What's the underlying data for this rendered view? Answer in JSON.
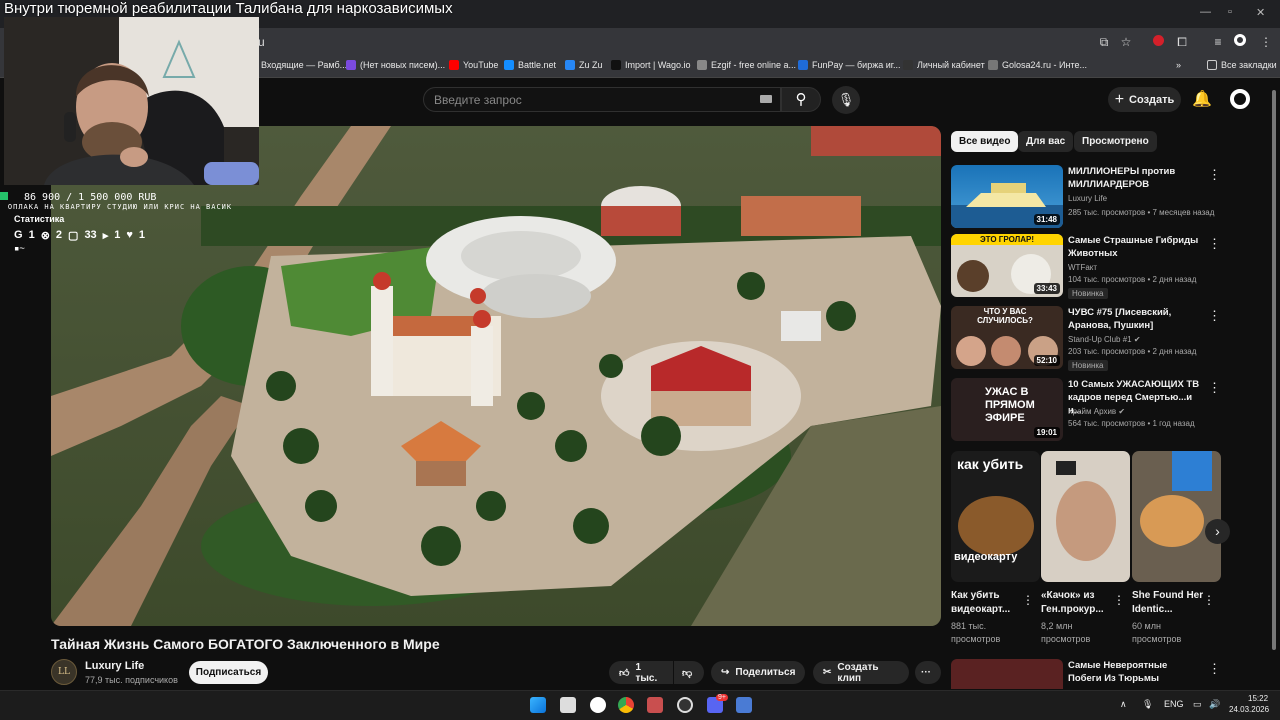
{
  "stream": {
    "title": "Внутри тюремной реабилитации Талибана для наркозависимых",
    "donation": "86 900 / 1 500 000 RUB",
    "donation_note": "ОПЛАКА НА КВАРТИРУ СТУДИЮ ИЛИ КРИС НА ВАСИК",
    "stats_label": "Статистика",
    "stats": [
      "1",
      "2",
      "33",
      "1",
      "1"
    ],
    "stats_extra": "~"
  },
  "browser": {
    "url": "u",
    "bookmarks": [
      {
        "label": "Входящие — Рамб...",
        "color": "#3b6bd6"
      },
      {
        "label": "(Нет новых писем)...",
        "color": "#7b4ae0"
      },
      {
        "label": "YouTube",
        "color": "#ff0000"
      },
      {
        "label": "Battle.net",
        "color": "#148eff"
      },
      {
        "label": "Zu Zu",
        "color": "#2787f5"
      },
      {
        "label": "Import | Wago.io",
        "color": "#111111"
      },
      {
        "label": "Ezgif - free online a...",
        "color": "#888888"
      },
      {
        "label": "FunPay — биржа иг...",
        "color": "#1f6bd8"
      },
      {
        "label": "Личный кабинет",
        "color": "#333333"
      },
      {
        "label": "Golosa24.ru - Инте...",
        "color": "#777777"
      }
    ],
    "all_bookmarks": "Все закладки",
    "more_bookmarks": "»"
  },
  "yt": {
    "search_placeholder": "Введите запрос",
    "create_label": "Создать"
  },
  "video": {
    "title": "Тайная Жизнь Самого БОГАТОГО Заключенного в Мире",
    "channel": "Luxury Life",
    "channel_avatar": "LL",
    "subscribers": "77,9 тыс. подписчиков",
    "subscribe_label": "Подписаться",
    "likes": "1 тыс.",
    "share_label": "Поделиться",
    "clip_label": "Создать клип",
    "more": "···"
  },
  "sidebar": {
    "chips": [
      "Все видео",
      "Для вас",
      "Просмотрено"
    ],
    "recommendations": [
      {
        "title": "МИЛЛИОНЕРЫ против МИЛЛИАРДЕРОВ",
        "channel": "Luxury Life",
        "meta": "285 тыс. просмотров • 7 месяцев назад",
        "duration": "31:48",
        "badge": "",
        "verified": false
      },
      {
        "title": "Самые Страшные Гибриды Животных",
        "channel": "WTFакт",
        "meta": "104 тыс. просмотров • 2 дня назад",
        "duration": "33:43",
        "badge": "Новинка",
        "thumb_text": "ЭТО ГРОЛАР!",
        "verified": false
      },
      {
        "title": "ЧУВС #75 [Лисевский, Аранова, Пушкин]",
        "channel": "Stand-Up Club #1",
        "meta": "203 тыс. просмотров • 2 дня назад",
        "duration": "52:10",
        "badge": "Новинка",
        "thumb_text": "ЧТО У ВАС СЛУЧИЛОСЬ?",
        "verified": true
      },
      {
        "title": "10 Самых УЖАСАЮЩИХ ТВ кадров перед Смертью...и н...",
        "channel": "Крайм Архив",
        "meta": "564 тыс. просмотров • 1 год назад",
        "duration": "19:01",
        "badge": "",
        "thumb_text": "УЖАС В ПРЯМОМ ЭФИРЕ",
        "verified": true
      }
    ],
    "shorts": [
      {
        "title": "Как убить видеокарт...",
        "views": "881 тыс. просмотров",
        "thumb_top": "как убить",
        "thumb_bottom": "видеокарту"
      },
      {
        "title": "«Качок» из Ген.прокур...",
        "views": "8,2 млн просмотров"
      },
      {
        "title": "She Found Her Identic...",
        "views": "60 млн просмотров"
      }
    ],
    "last_rec": {
      "title": "Самые Невероятные Побеги Из Тюрьмы"
    }
  },
  "taskbar": {
    "lang": "ENG",
    "time": "15:22",
    "date": "24.03.2026",
    "discord_badge": "9+"
  }
}
